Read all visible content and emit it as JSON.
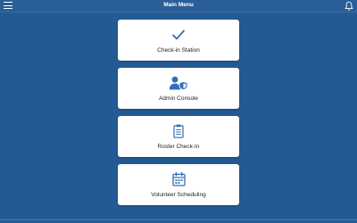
{
  "header": {
    "title": "Main Menu",
    "menu_icon": "hamburger-menu-icon",
    "notification_icon": "bell-icon"
  },
  "menu_items": [
    {
      "label": "Check-in Station",
      "icon": "checkmark-icon"
    },
    {
      "label": "Admin Console",
      "icon": "admin-user-shield-icon"
    },
    {
      "label": "Roster Check-In",
      "icon": "clipboard-icon"
    },
    {
      "label": "Volunteer Scheduling",
      "icon": "calendar-icon"
    }
  ],
  "colors": {
    "background": "#245a94",
    "accent": "#2f6fb8",
    "card": "#ffffff"
  }
}
